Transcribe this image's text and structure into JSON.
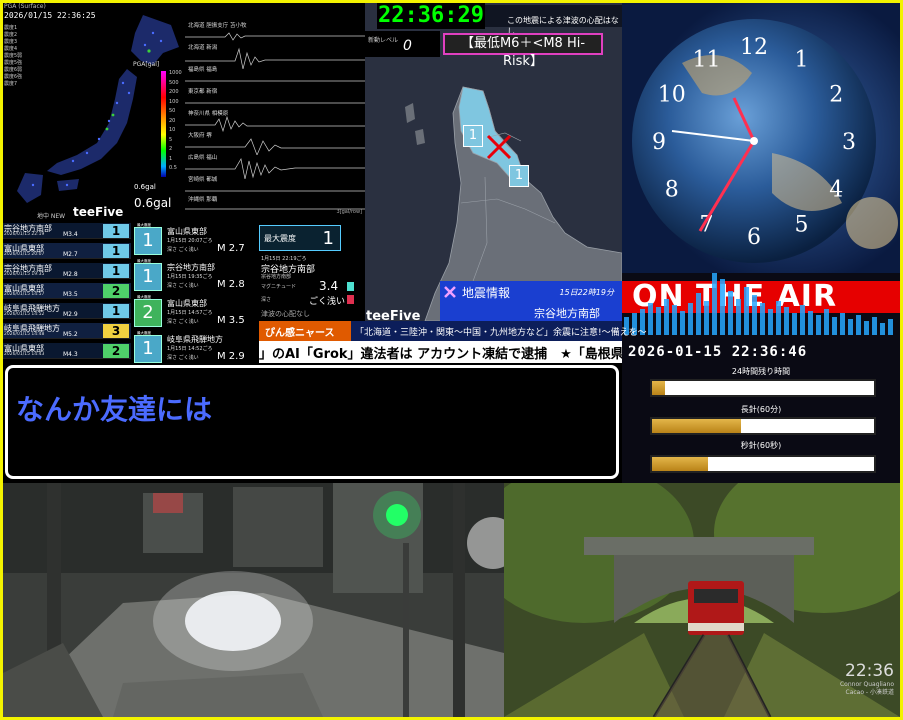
{
  "map": {
    "timestamp": "2026/01/15 22:36:25",
    "header": "PGA (Surface)",
    "stats": [
      "震度1",
      "震度2",
      "震度3",
      "震度4",
      "震度5弱",
      "震度5強",
      "震度6弱",
      "震度6強",
      "震度7"
    ],
    "pga_label": "PGA[gal]",
    "pga_ticks": [
      "1000",
      "500",
      "200",
      "100",
      "50",
      "20",
      "10",
      "5",
      "2",
      "1",
      "0.5"
    ],
    "gal_small": "0.6gal",
    "gal_big": "0.6gal",
    "brand": "teeFive",
    "bottom_label": "地中 NEW"
  },
  "waves": {
    "stations": [
      "北海道 胆振支庁 苫小牧",
      "北海道 新潟",
      "福島県 福島",
      "東京都 新宿",
      "神奈川県 相模原",
      "大阪府 堺",
      "広島県 福山",
      "宮崎県 都城",
      "沖縄県 那覇"
    ],
    "footer": "3[gal/row]"
  },
  "quake": {
    "clock": "22:36:29",
    "message": "この地震による津波の心配はなし",
    "level_label": "新動レベル",
    "level_value": "0",
    "risk": "【最低M6＋<M8 Hi-Risk】",
    "marker_1": "1",
    "marker_2": "1",
    "info_title": "地震情報",
    "info_time": "15日22時19分",
    "info_area": "宗谷地方南部",
    "brand": "teeFive"
  },
  "clock": {
    "numbers": [
      "12",
      "1",
      "2",
      "3",
      "4",
      "5",
      "6",
      "7",
      "8",
      "9",
      "10",
      "11"
    ]
  },
  "air": {
    "banner": "ON THE AIR",
    "datetime": "2026-01-15 22:36:46",
    "progress": [
      {
        "label": "24時間残り時間",
        "fraction": 0.06
      },
      {
        "label": "長針(60分)",
        "fraction": 0.4
      },
      {
        "label": "秒針(60秒)",
        "fraction": 0.25
      }
    ],
    "color_gold": "#d2a23a"
  },
  "quake_list": [
    {
      "name": "宗谷地方南部",
      "date": "2026/01/15 22:19",
      "mag": "M3.4",
      "shindo": "1"
    },
    {
      "name": "富山県東部",
      "date": "2026/01/15 20:07",
      "mag": "M2.7",
      "shindo": "1"
    },
    {
      "name": "宗谷地方南部",
      "date": "2026/01/15 19:35",
      "mag": "M2.8",
      "shindo": "1"
    },
    {
      "name": "富山県東部",
      "date": "2026/01/15 14:57",
      "mag": "M3.5",
      "shindo": "2"
    },
    {
      "name": "岐阜県飛騨地方",
      "date": "2026/01/15 14:52",
      "mag": "M2.9",
      "shindo": "1"
    },
    {
      "name": "岐阜県飛騨地方",
      "date": "2026/01/15 14:48",
      "mag": "M5.2",
      "shindo": "3"
    },
    {
      "name": "富山県東部",
      "date": "2026/01/15 14:43",
      "mag": "M4.3",
      "shindo": "2"
    }
  ],
  "quake_list2": [
    {
      "name": "富山県東部",
      "date": "1月15日 20:07ごろ",
      "depth": "深さ ごく浅い",
      "mag": "M 2.7",
      "shindo": "1"
    },
    {
      "name": "宗谷地方南部",
      "date": "1月15日 19:35ごろ",
      "depth": "深さ ごく浅い",
      "mag": "M 2.8",
      "shindo": "1"
    },
    {
      "name": "富山県東部",
      "date": "1月15日 14:57ごろ",
      "depth": "深さ ごく浅い",
      "mag": "M 3.5",
      "shindo": "2"
    },
    {
      "name": "岐阜県飛騨地方",
      "date": "1月15日 14:52ごろ",
      "depth": "深さ ごく浅い",
      "mag": "M 2.9",
      "shindo": "1"
    }
  ],
  "quake_list_badge": "最大震度",
  "detail": {
    "box_label": "最大震度",
    "box_value": "1",
    "date": "1月15日 22:19ごろ",
    "area": "宗谷地方南部",
    "area_sub": "宗谷地方南部",
    "mag_label": "マグニチュード",
    "mag_value": "3.4",
    "depth_label": "深さ",
    "depth_value": "ごく浅い",
    "tsunami": "津波の心配なし"
  },
  "news": {
    "tag": "ぴん感ニャース",
    "text": "「北海道・三陸沖・関東〜中国・九州地方など」余震に注意!〜備えを〜"
  },
  "ticker": "」のAI「Grok」違法者は アカウント凍結で逮捕　★「島根県",
  "subtitle": "なんか友達には",
  "cam_rail": {
    "time": "22:36",
    "caption_1": "Connor Quagliano",
    "caption_2": "Cacao - 小湊鉄道"
  }
}
